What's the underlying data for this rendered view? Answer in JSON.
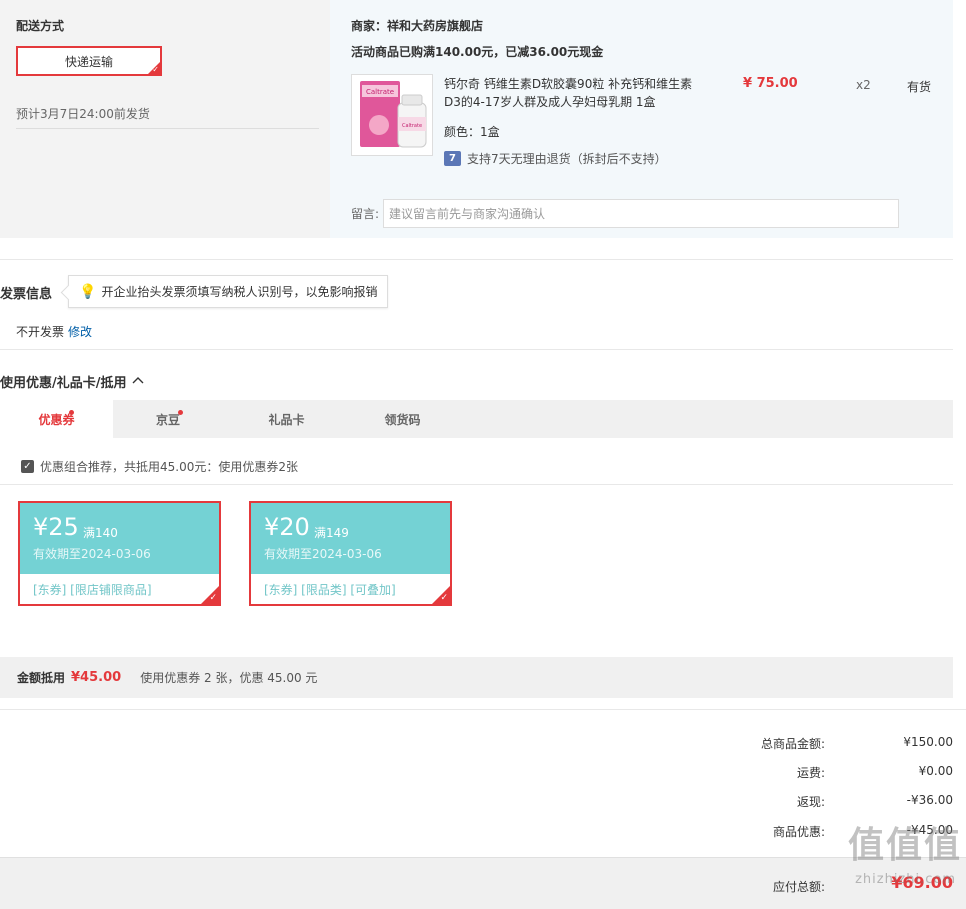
{
  "shipping": {
    "title": "配送方式",
    "method": "快递运输",
    "estimate": "预计3月7日24:00前发货"
  },
  "store": {
    "merchant": "商家：祥和大药房旗舰店",
    "promo": "活动商品已购满140.00元，已减36.00元现金",
    "product": {
      "name": "钙尔奇 钙维生素D软胶囊90粒 补充钙和维生素D3的4-17岁人群及成人孕妇母乳期 1盒",
      "color": "颜色：1盒",
      "return_icon": "7",
      "return_policy": "支持7天无理由退货（拆封后不支持）",
      "price": "¥ 75.00",
      "qty": "x2",
      "stock": "有货"
    },
    "memo_label": "留言:",
    "memo_placeholder": "建议留言前先与商家沟通确认"
  },
  "invoice": {
    "title": "发票信息",
    "tip": "开企业抬头发票须填写纳税人识别号，以免影响报销",
    "value": "不开发票",
    "edit": "修改"
  },
  "coupons": {
    "title": "使用优惠/礼品卡/抵用",
    "tabs": [
      {
        "label": "优惠券",
        "dot": true
      },
      {
        "label": "京豆",
        "dot": true
      },
      {
        "label": "礼品卡",
        "dot": false
      },
      {
        "label": "领货码",
        "dot": false
      }
    ],
    "recommend": "优惠组合推荐，共抵用45.00元：使用优惠券2张",
    "items": [
      {
        "amount": "¥25",
        "condition": "满140",
        "expiry": "有效期至2024-03-06",
        "tags": "[东券]  [限店铺限商品]"
      },
      {
        "amount": "¥20",
        "condition": "满149",
        "expiry": "有效期至2024-03-06",
        "tags": "[东券]  [限品类]  [可叠加]"
      }
    ],
    "summary_label": "金额抵用",
    "summary_amount": "¥45.00",
    "summary_desc": "使用优惠券 2 张，优惠 45.00 元"
  },
  "totals": {
    "rows": [
      {
        "label": "总商品金额:",
        "value": "¥150.00"
      },
      {
        "label": "运费:",
        "value": "¥0.00"
      },
      {
        "label": "返现:",
        "value": "-¥36.00"
      },
      {
        "label": "商品优惠:",
        "value": "-¥45.00"
      }
    ],
    "pay_label": "应付总额:",
    "pay_value": "¥69.00"
  },
  "watermark": {
    "main": "值值值",
    "sub": "zhizhizhi.com"
  },
  "colors": {
    "accent": "#e4393c",
    "coupon": "#74d2d4",
    "link": "#005ea7"
  }
}
